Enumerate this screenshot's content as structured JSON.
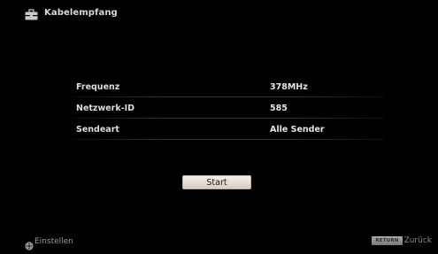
{
  "header": {
    "icon": "toolbox-icon",
    "title": "Kabelempfang"
  },
  "settings": {
    "rows": [
      {
        "label": "Frequenz",
        "value": "378MHz"
      },
      {
        "label": "Netzwerk-ID",
        "value": "585"
      },
      {
        "label": "Sendeart",
        "value": "Alle Sender"
      }
    ]
  },
  "start_button": {
    "label": "Start"
  },
  "footer": {
    "left_icon": "dpad-icon",
    "left_label": "Einstellen",
    "return_key": "RETURN",
    "right_label": "Zurück"
  },
  "colors": {
    "background": "#000000",
    "text": "#dcdcdc",
    "button_face": "#e5ddd2",
    "icon_accent": "#c9c9c9"
  }
}
